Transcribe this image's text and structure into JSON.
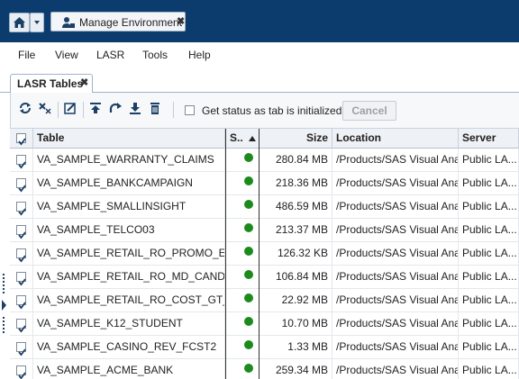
{
  "header": {
    "tab_title": "Manage Environment",
    "home_icon": "home-icon",
    "dropdown_icon": "chevron-down-icon",
    "close_glyph": "✖"
  },
  "menu": [
    "File",
    "View",
    "LASR",
    "Tools",
    "Help"
  ],
  "panel_tab": {
    "label": "LASR Tables",
    "close_glyph": "✖"
  },
  "toolbar": {
    "icons": [
      "refresh-icon",
      "clear-filter-icon",
      "edit-icon",
      "load-icon",
      "reload-icon",
      "download-icon",
      "delete-icon"
    ],
    "status_checkbox_label": "Get status as tab is initialized",
    "cancel_label": "Cancel"
  },
  "table": {
    "columns": [
      "Table",
      "S..",
      "Size",
      "Location",
      "Server"
    ],
    "rows": [
      {
        "table": "VA_SAMPLE_WARRANTY_CLAIMS",
        "size": "280.84 MB",
        "location": "/Products/SAS Visual Ana...",
        "server": "Public LA..."
      },
      {
        "table": "VA_SAMPLE_BANKCAMPAIGN",
        "size": "218.36 MB",
        "location": "/Products/SAS Visual Ana...",
        "server": "Public LA..."
      },
      {
        "table": "VA_SAMPLE_SMALLINSIGHT",
        "size": "486.59 MB",
        "location": "/Products/SAS Visual Ana...",
        "server": "Public LA..."
      },
      {
        "table": "VA_SAMPLE_TELCO03",
        "size": "213.37 MB",
        "location": "/Products/SAS Visual Ana...",
        "server": "Public LA..."
      },
      {
        "table": "VA_SAMPLE_RETAIL_RO_PROMO_EF...",
        "size": "126.32 KB",
        "location": "/Products/SAS Visual Ana...",
        "server": "Public LA..."
      },
      {
        "table": "VA_SAMPLE_RETAIL_RO_MD_CANDID...",
        "size": "106.84 MB",
        "location": "/Products/SAS Visual Ana...",
        "server": "Public LA..."
      },
      {
        "table": "VA_SAMPLE_RETAIL_RO_COST_GT_...",
        "size": "22.92 MB",
        "location": "/Products/SAS Visual Ana...",
        "server": "Public LA..."
      },
      {
        "table": "VA_SAMPLE_K12_STUDENT",
        "size": "10.70 MB",
        "location": "/Products/SAS Visual Ana...",
        "server": "Public LA..."
      },
      {
        "table": "VA_SAMPLE_CASINO_REV_FCST2",
        "size": "1.33 MB",
        "location": "/Products/SAS Visual Ana...",
        "server": "Public LA..."
      },
      {
        "table": "VA_SAMPLE_ACME_BANK",
        "size": "259.34 MB",
        "location": "/Products/SAS Visual Ana...",
        "server": "Public LA..."
      }
    ]
  },
  "colors": {
    "titlebar": "#0c3c6e",
    "status_ok": "#1c8a1c",
    "accent": "#1b3f66"
  }
}
